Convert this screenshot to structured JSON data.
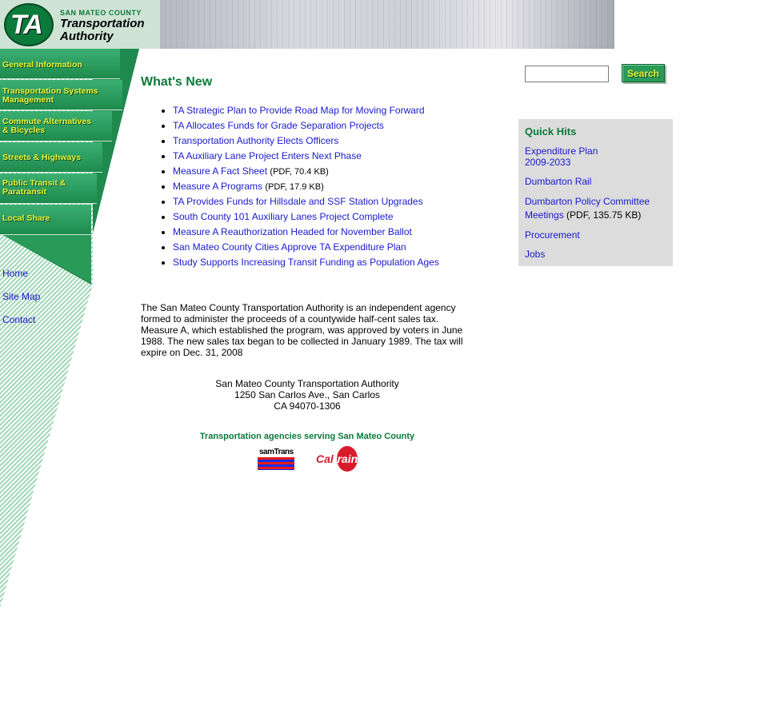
{
  "header": {
    "logo_mark": "TA",
    "county": "SAN MATEO COUNTY",
    "name_line1": "Transportation",
    "name_line2": "Authority"
  },
  "sidebar": {
    "items": [
      {
        "label_line1": "General Information",
        "label_line2": ""
      },
      {
        "label_line1": "Transportation Systems",
        "label_line2": "Management"
      },
      {
        "label_line1": "Commute Alternatives",
        "label_line2": "& Bicycles"
      },
      {
        "label_line1": "Streets & Highways",
        "label_line2": ""
      },
      {
        "label_line1": "Public Transit &",
        "label_line2": "Paratransit"
      },
      {
        "label_line1": "Local Share",
        "label_line2": ""
      }
    ],
    "links": [
      "Home",
      "Site Map",
      "Contact"
    ]
  },
  "search": {
    "value": "",
    "button_label": "Search"
  },
  "main": {
    "title": "What's New",
    "news": [
      {
        "text": "TA Strategic Plan to Provide Road Map for Moving Forward",
        "extra": ""
      },
      {
        "text": "TA Allocates Funds for Grade Separation Projects",
        "extra": ""
      },
      {
        "text": "Transportation Authority Elects Officers",
        "extra": ""
      },
      {
        "text": "TA Auxiliary Lane Project Enters Next Phase",
        "extra": ""
      },
      {
        "text": "Measure A Fact Sheet",
        "extra": "(PDF, 70.4 KB)"
      },
      {
        "text": "Measure A Programs",
        "extra": "(PDF, 17.9 KB)"
      },
      {
        "text": "TA Provides Funds for Hillsdale and SSF Station Upgrades",
        "extra": ""
      },
      {
        "text": "South County 101 Auxiliary Lanes Project Complete",
        "extra": ""
      },
      {
        "text": "Measure A Reauthorization Headed for November Ballot",
        "extra": ""
      },
      {
        "text": "San Mateo County Cities Approve TA Expenditure Plan",
        "extra": ""
      },
      {
        "text": "Study Supports Increasing Transit Funding as Population Ages",
        "extra": ""
      }
    ],
    "about": "The San Mateo County Transportation Authority is an independent agency formed to administer the proceeds of a countywide half-cent sales tax. Measure A, which established the program, was approved by voters in June 1988. The new sales tax began to be collected in January 1989. The tax will expire on Dec. 31, 2008",
    "address": {
      "line1": "San Mateo County Transportation Authority",
      "line2": "1250 San Carlos Ave., San Carlos",
      "line3": "CA 94070-1306"
    },
    "agencies_label": "Transportation agencies serving San Mateo County",
    "samtrans_text": "samTrans",
    "caltrain_text_a": "Cal",
    "caltrain_text_b": "train"
  },
  "quick_hits": {
    "title": "Quick Hits",
    "items": [
      {
        "line1": "Expenditure Plan",
        "line2": "2009-2033"
      },
      {
        "line1": "Dumbarton Rail",
        "line2": ""
      },
      {
        "line1": "Dumbarton Policy Committee",
        "line2": "Meetings",
        "extra": "(PDF, 135.75 KB)"
      },
      {
        "line1": "Procurement",
        "line2": ""
      },
      {
        "line1": "Jobs",
        "line2": ""
      }
    ]
  },
  "colors": {
    "brand_green": "#0b7a3a",
    "nav_text_yellow": "#e9f23a",
    "link_blue": "#1a1acc",
    "quick_hits_bg": "#dcdcdc"
  }
}
